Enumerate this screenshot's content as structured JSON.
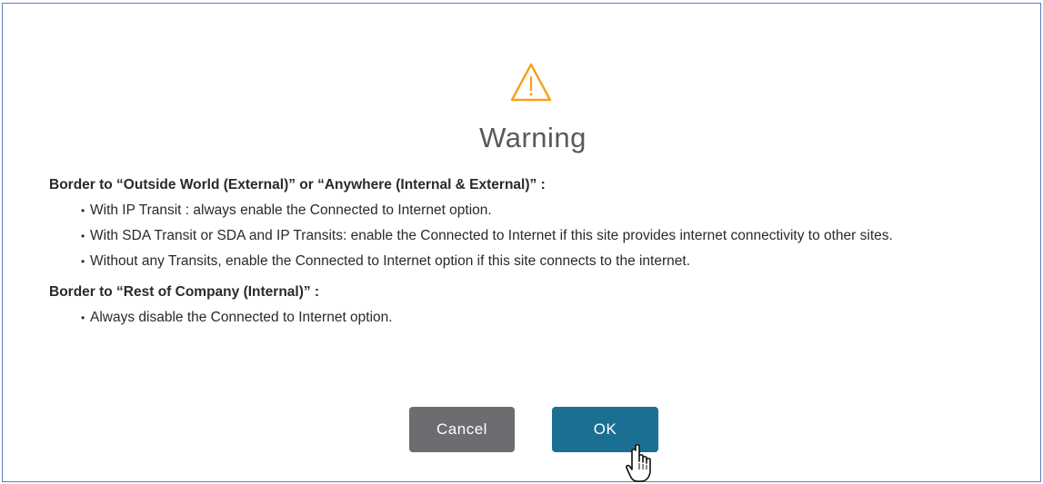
{
  "dialog": {
    "title": "Warning",
    "icon": "warning-triangle-icon",
    "accent_color": "#f7a11a",
    "sections": [
      {
        "heading": "Border to “Outside World (External)” or “Anywhere (Internal & External)” :",
        "items": [
          "With IP Transit : always enable the Connected to Internet option.",
          "With SDA Transit or SDA and IP Transits: enable the Connected to Internet if this site provides internet connectivity to other sites.",
          "Without any Transits, enable the Connected to Internet option if this site connects to the internet."
        ]
      },
      {
        "heading": "Border to “Rest of Company (Internal)” :",
        "items": [
          "Always disable the Connected to Internet option."
        ]
      }
    ],
    "buttons": {
      "cancel_label": "Cancel",
      "cancel_color": "#6c6d70",
      "ok_label": "OK",
      "ok_color": "#1b6f93"
    },
    "cursor_icon": "hand-pointer-icon"
  }
}
